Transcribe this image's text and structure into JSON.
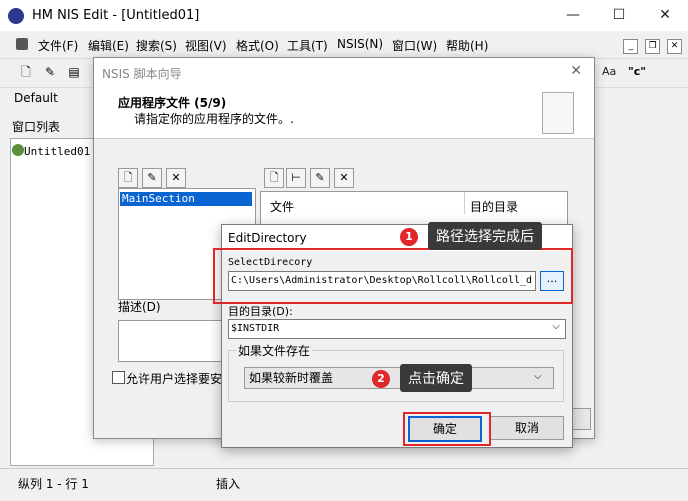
{
  "app": {
    "title": "HM NIS Edit - [Untitled01]",
    "menu": [
      "文件(F)",
      "编辑(E)",
      "搜索(S)",
      "视图(V)",
      "格式(O)",
      "工具(T)",
      "NSIS(N)",
      "窗口(W)",
      "帮助(H)"
    ],
    "toolbar_combo": "Default",
    "toolbar_text_icon": "Aa",
    "toolbar_quote_icon": "\"c\"",
    "window_list_label": "窗口列表",
    "tree_root": "Untitled01",
    "status_position": "纵列 1 - 行 1",
    "status_mode": "插入"
  },
  "wizard": {
    "title": "NSIS 脚本向导",
    "header_title": "应用程序文件 (5/9)",
    "header_subtitle": "请指定你的应用程序的文件。.",
    "section_item": "MainSection",
    "desc_label": "描述(D)",
    "allow_label": "允许用户选择要安",
    "col_file": "文件",
    "col_dest": "目的目录"
  },
  "editdir": {
    "title": "EditDirectory",
    "select_label": "SelectDirecory",
    "path_value": "C:\\Users\\Administrator\\Desktop\\Rollcoll\\Rollcoll_d",
    "browse_label": "...",
    "dest_label": "目的目录(D):",
    "dest_value": "$INSTDIR",
    "group_label": "如果文件存在",
    "overwrite_value": "如果较新时覆盖",
    "ok_label": "确定",
    "cancel_label": "取消"
  },
  "annotations": {
    "badge1": "1",
    "callout1": "路径选择完成后",
    "badge2": "2",
    "callout2": "点击确定"
  },
  "colors": {
    "accent": "#0a64d2",
    "annotation_red": "#e0282a"
  }
}
